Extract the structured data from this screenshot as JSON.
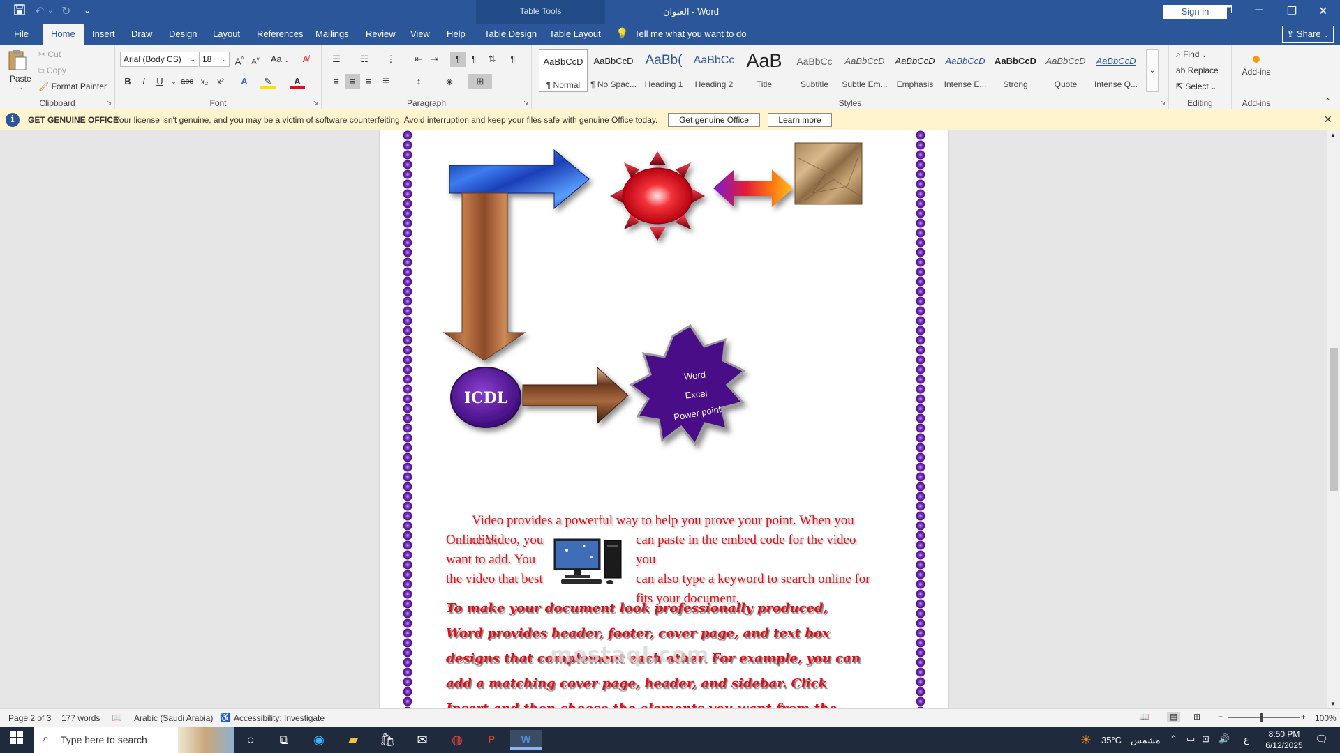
{
  "titlebar": {
    "doc_title": "العنوان",
    "separator": "-",
    "app_name": "Word",
    "table_tools": "Table Tools",
    "sign_in": "Sign in",
    "qat_more": "⌄"
  },
  "tabs": [
    "File",
    "Home",
    "Insert",
    "Draw",
    "Design",
    "Layout",
    "References",
    "Mailings",
    "Review",
    "View",
    "Help",
    "Table Design",
    "Table Layout"
  ],
  "tell_me": "Tell me what you want to do",
  "share": "Share",
  "clipboard": {
    "paste": "Paste",
    "cut": "Cut",
    "copy": "Copy",
    "format_painter": "Format Painter",
    "label": "Clipboard"
  },
  "font": {
    "name": "Arial (Body CS)",
    "size": "18",
    "label": "Font",
    "aa": "Aa"
  },
  "paragraph": {
    "label": "Paragraph"
  },
  "styles": {
    "label": "Styles",
    "items": [
      {
        "preview": "AaBbCcD",
        "name": "¶ Normal"
      },
      {
        "preview": "AaBbCcD",
        "name": "¶ No Spac..."
      },
      {
        "preview": "AaBb(",
        "name": "Heading 1"
      },
      {
        "preview": "AaBbCc",
        "name": "Heading 2"
      },
      {
        "preview": "AaB",
        "name": "Title"
      },
      {
        "preview": "AaBbCc",
        "name": "Subtitle"
      },
      {
        "preview": "AaBbCcD",
        "name": "Subtle Em..."
      },
      {
        "preview": "AaBbCcD",
        "name": "Emphasis"
      },
      {
        "preview": "AaBbCcD",
        "name": "Intense E..."
      },
      {
        "preview": "AaBbCcD",
        "name": "Strong"
      },
      {
        "preview": "AaBbCcD",
        "name": "Quote"
      },
      {
        "preview": "AaBbCcD",
        "name": "Intense Q..."
      }
    ]
  },
  "editing": {
    "find": "Find",
    "replace": "Replace",
    "select": "Select",
    "label": "Editing"
  },
  "addins": {
    "button": "Add-ins",
    "label": "Add-ins"
  },
  "notice": {
    "heading": "GET GENUINE OFFICE",
    "message": "Your license isn't genuine, and you may be a victim of software counterfeiting. Avoid interruption and keep your files safe with genuine Office today.",
    "btn_genuine": "Get genuine Office",
    "btn_learn": "Learn more"
  },
  "document": {
    "icdl": "ICDL",
    "star_items": [
      "Word",
      "Excel",
      "Power point"
    ],
    "para1_line1": "Video provides a powerful way to help you prove your point. When you click",
    "para1_left": [
      "Online Video, you",
      "want to add. You",
      "the video that best"
    ],
    "para1_right": [
      "can paste in the embed code for the video you",
      "can also type a keyword to search online for",
      "fits your document."
    ],
    "para2": "To make your document look professionally produced, Word provides header, footer, cover page, and text box designs that complement each other. For example, you can add a matching cover page, header, and sidebar. Click Insert and then choose the elements you want from the different galleries."
  },
  "status": {
    "page": "Page 2 of 3",
    "words": "177 words",
    "language": "Arabic (Saudi Arabia)",
    "accessibility": "Accessibility: Investigate",
    "zoom": "100%"
  },
  "taskbar": {
    "search_placeholder": "Type here to search",
    "temp": "35°C",
    "weather": "مشمس",
    "lang": "ع",
    "time": "8:50 PM",
    "date": "6/12/2025"
  },
  "watermark": "mostaql.com",
  "colors": {
    "word_blue": "#2b579a",
    "doc_red": "#e0101a",
    "border_purple": "#7a2fc6",
    "notice_bg": "#fff4ce"
  }
}
